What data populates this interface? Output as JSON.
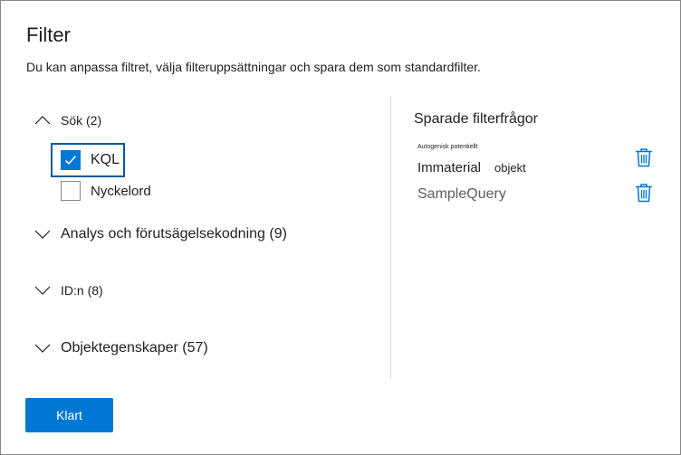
{
  "dialog": {
    "title": "Filter",
    "description": "Du kan anpassa filtret, välja filteruppsättningar och spara dem som standardfilter."
  },
  "groups": {
    "search": {
      "label": "Sök (2)",
      "expanded": true
    },
    "analysis": {
      "label": "Analys och förutsägelsekodning (9)",
      "expanded": false
    },
    "ids": {
      "label": "ID:n (8)",
      "expanded": false
    },
    "properties": {
      "label": "Objektegenskaper (57)",
      "expanded": false
    }
  },
  "search_options": [
    {
      "label": "KQL",
      "checked": true
    },
    {
      "label": "Nyckelord",
      "checked": false
    }
  ],
  "saved": {
    "title": "Sparade filterfrågor",
    "query1_tiny": "Autogenisk potentiellt",
    "query1_a": "Immaterial",
    "query1_b": "objekt",
    "query2": "SampleQuery"
  },
  "icons": {
    "chevron_up": "chevron-up-icon",
    "chevron_down": "chevron-down-icon",
    "check": "checkmark-icon",
    "trash": "trash-icon"
  },
  "colors": {
    "accent": "#0078d4",
    "icon_blue": "#0078d4",
    "text": "#201f1e"
  },
  "footer": {
    "done_label": "Klart"
  }
}
